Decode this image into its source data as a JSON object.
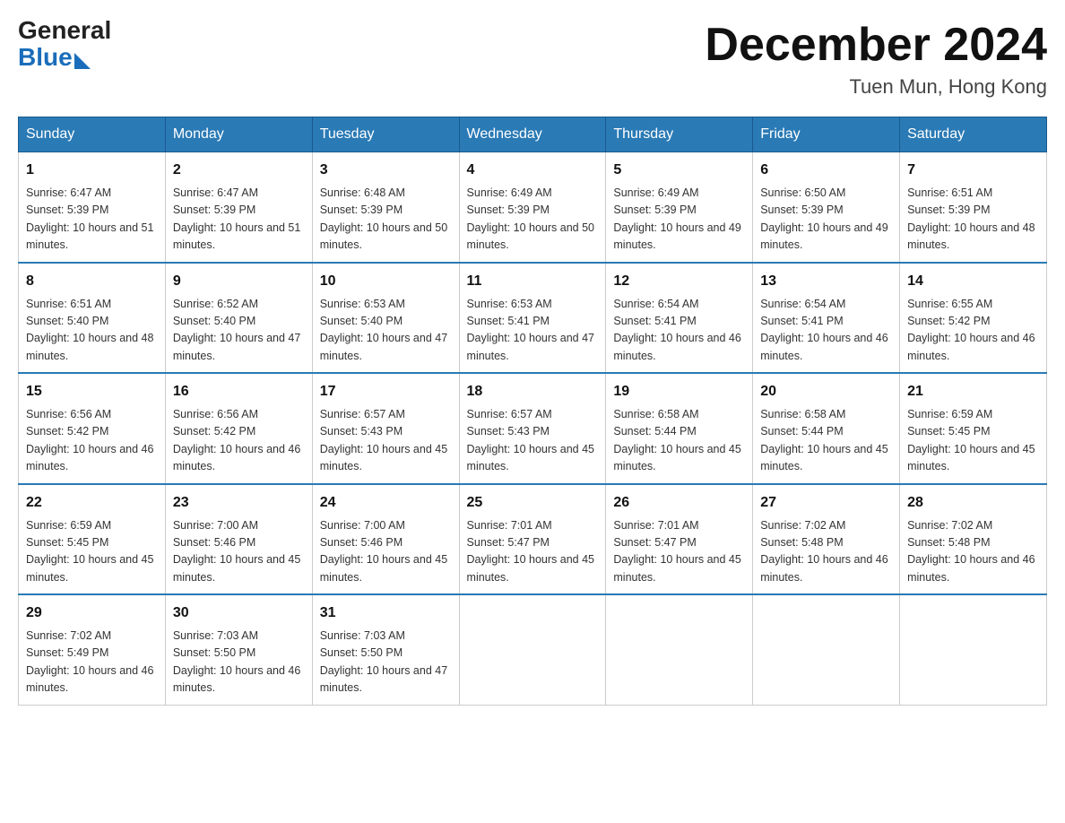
{
  "header": {
    "logo_general": "General",
    "logo_blue": "Blue",
    "month_title": "December 2024",
    "location": "Tuen Mun, Hong Kong"
  },
  "days_of_week": [
    "Sunday",
    "Monday",
    "Tuesday",
    "Wednesday",
    "Thursday",
    "Friday",
    "Saturday"
  ],
  "weeks": [
    [
      {
        "day": "1",
        "sunrise": "6:47 AM",
        "sunset": "5:39 PM",
        "daylight": "10 hours and 51 minutes."
      },
      {
        "day": "2",
        "sunrise": "6:47 AM",
        "sunset": "5:39 PM",
        "daylight": "10 hours and 51 minutes."
      },
      {
        "day": "3",
        "sunrise": "6:48 AM",
        "sunset": "5:39 PM",
        "daylight": "10 hours and 50 minutes."
      },
      {
        "day": "4",
        "sunrise": "6:49 AM",
        "sunset": "5:39 PM",
        "daylight": "10 hours and 50 minutes."
      },
      {
        "day": "5",
        "sunrise": "6:49 AM",
        "sunset": "5:39 PM",
        "daylight": "10 hours and 49 minutes."
      },
      {
        "day": "6",
        "sunrise": "6:50 AM",
        "sunset": "5:39 PM",
        "daylight": "10 hours and 49 minutes."
      },
      {
        "day": "7",
        "sunrise": "6:51 AM",
        "sunset": "5:39 PM",
        "daylight": "10 hours and 48 minutes."
      }
    ],
    [
      {
        "day": "8",
        "sunrise": "6:51 AM",
        "sunset": "5:40 PM",
        "daylight": "10 hours and 48 minutes."
      },
      {
        "day": "9",
        "sunrise": "6:52 AM",
        "sunset": "5:40 PM",
        "daylight": "10 hours and 47 minutes."
      },
      {
        "day": "10",
        "sunrise": "6:53 AM",
        "sunset": "5:40 PM",
        "daylight": "10 hours and 47 minutes."
      },
      {
        "day": "11",
        "sunrise": "6:53 AM",
        "sunset": "5:41 PM",
        "daylight": "10 hours and 47 minutes."
      },
      {
        "day": "12",
        "sunrise": "6:54 AM",
        "sunset": "5:41 PM",
        "daylight": "10 hours and 46 minutes."
      },
      {
        "day": "13",
        "sunrise": "6:54 AM",
        "sunset": "5:41 PM",
        "daylight": "10 hours and 46 minutes."
      },
      {
        "day": "14",
        "sunrise": "6:55 AM",
        "sunset": "5:42 PM",
        "daylight": "10 hours and 46 minutes."
      }
    ],
    [
      {
        "day": "15",
        "sunrise": "6:56 AM",
        "sunset": "5:42 PM",
        "daylight": "10 hours and 46 minutes."
      },
      {
        "day": "16",
        "sunrise": "6:56 AM",
        "sunset": "5:42 PM",
        "daylight": "10 hours and 46 minutes."
      },
      {
        "day": "17",
        "sunrise": "6:57 AM",
        "sunset": "5:43 PM",
        "daylight": "10 hours and 45 minutes."
      },
      {
        "day": "18",
        "sunrise": "6:57 AM",
        "sunset": "5:43 PM",
        "daylight": "10 hours and 45 minutes."
      },
      {
        "day": "19",
        "sunrise": "6:58 AM",
        "sunset": "5:44 PM",
        "daylight": "10 hours and 45 minutes."
      },
      {
        "day": "20",
        "sunrise": "6:58 AM",
        "sunset": "5:44 PM",
        "daylight": "10 hours and 45 minutes."
      },
      {
        "day": "21",
        "sunrise": "6:59 AM",
        "sunset": "5:45 PM",
        "daylight": "10 hours and 45 minutes."
      }
    ],
    [
      {
        "day": "22",
        "sunrise": "6:59 AM",
        "sunset": "5:45 PM",
        "daylight": "10 hours and 45 minutes."
      },
      {
        "day": "23",
        "sunrise": "7:00 AM",
        "sunset": "5:46 PM",
        "daylight": "10 hours and 45 minutes."
      },
      {
        "day": "24",
        "sunrise": "7:00 AM",
        "sunset": "5:46 PM",
        "daylight": "10 hours and 45 minutes."
      },
      {
        "day": "25",
        "sunrise": "7:01 AM",
        "sunset": "5:47 PM",
        "daylight": "10 hours and 45 minutes."
      },
      {
        "day": "26",
        "sunrise": "7:01 AM",
        "sunset": "5:47 PM",
        "daylight": "10 hours and 45 minutes."
      },
      {
        "day": "27",
        "sunrise": "7:02 AM",
        "sunset": "5:48 PM",
        "daylight": "10 hours and 46 minutes."
      },
      {
        "day": "28",
        "sunrise": "7:02 AM",
        "sunset": "5:48 PM",
        "daylight": "10 hours and 46 minutes."
      }
    ],
    [
      {
        "day": "29",
        "sunrise": "7:02 AM",
        "sunset": "5:49 PM",
        "daylight": "10 hours and 46 minutes."
      },
      {
        "day": "30",
        "sunrise": "7:03 AM",
        "sunset": "5:50 PM",
        "daylight": "10 hours and 46 minutes."
      },
      {
        "day": "31",
        "sunrise": "7:03 AM",
        "sunset": "5:50 PM",
        "daylight": "10 hours and 47 minutes."
      },
      null,
      null,
      null,
      null
    ]
  ]
}
